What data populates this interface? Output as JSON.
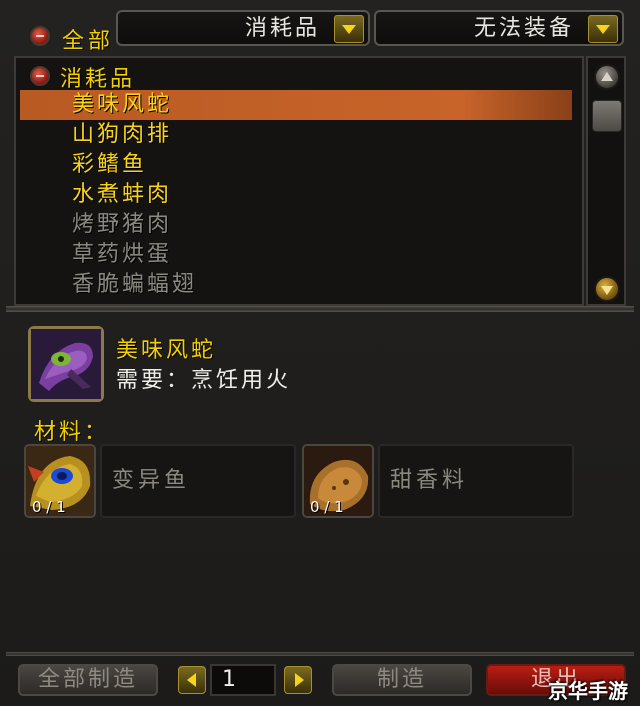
{
  "filters": {
    "all_label": "全部",
    "category_dropdown": "消耗品",
    "equip_dropdown": "无法装备"
  },
  "recipe_list": {
    "group_label": "消耗品",
    "items": [
      {
        "name": "美味风蛇",
        "color": "#f7d31a",
        "selected": true
      },
      {
        "name": "山狗肉排",
        "color": "#f7d31a",
        "selected": false
      },
      {
        "name": "彩鳍鱼",
        "color": "#f7d31a",
        "selected": false
      },
      {
        "name": "水煮蚌肉",
        "color": "#f7d31a",
        "selected": false
      },
      {
        "name": "烤野猪肉",
        "color": "#8c8880",
        "selected": false
      },
      {
        "name": "草药烘蛋",
        "color": "#8c8880",
        "selected": false
      },
      {
        "name": "香脆蝙蝠翅",
        "color": "#8c8880",
        "selected": false
      }
    ]
  },
  "detail": {
    "title": "美味风蛇",
    "requires": "需要：烹饪用火",
    "materials_label": "材料：",
    "reagents": [
      {
        "name": "变异鱼",
        "count": "0 / 1"
      },
      {
        "name": "甜香料",
        "count": "0 / 1"
      }
    ]
  },
  "bottom": {
    "create_all_label": "全部制造",
    "quantity": "1",
    "create_label": "制造",
    "exit_label": "退出"
  },
  "watermark": "京华手游",
  "colors": {
    "selected_bg": "#b85a22",
    "gold_text": "#f7d31a",
    "gray_text": "#8c8880"
  }
}
